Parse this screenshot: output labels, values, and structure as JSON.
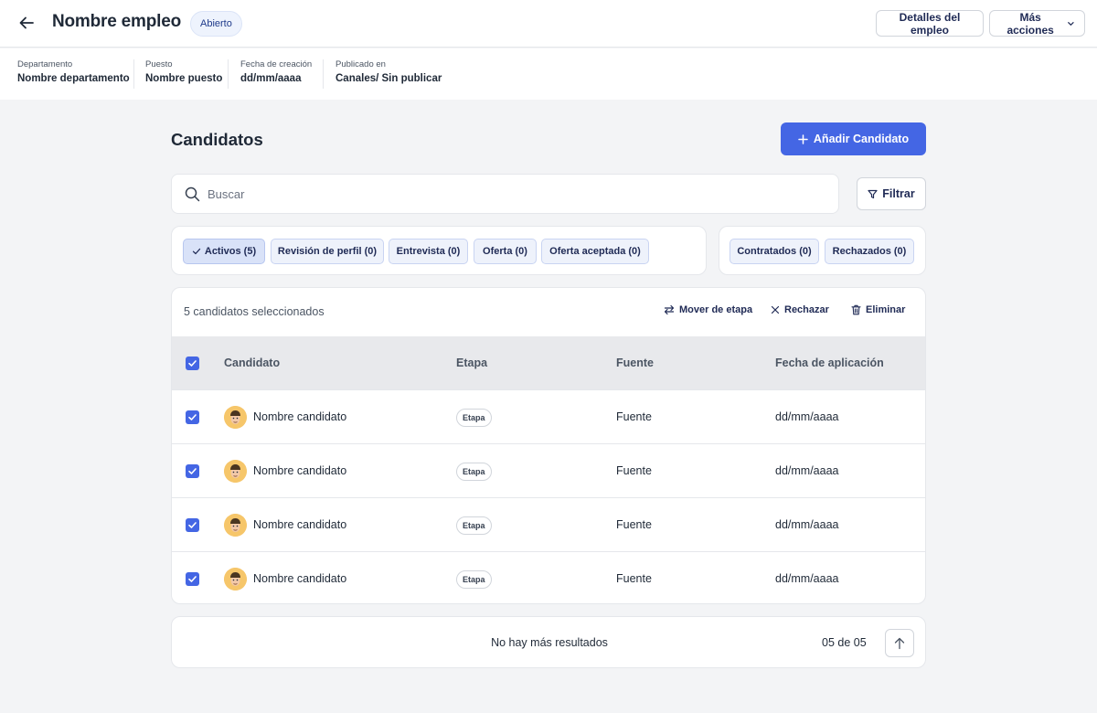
{
  "header": {
    "title": "Nombre empleo",
    "status": "Abierto",
    "details_label": "Detalles del empleo",
    "more_label": "Más acciones"
  },
  "meta": [
    {
      "label": "Departamento",
      "value": "Nombre departamento"
    },
    {
      "label": "Puesto",
      "value": "Nombre puesto"
    },
    {
      "label": "Fecha de creación",
      "value": "dd/mm/aaaa"
    },
    {
      "label": "Publicado en",
      "value": "Canales/ Sin publicar"
    }
  ],
  "main": {
    "title": "Candidatos",
    "add_label": "Añadir Candidato",
    "search_placeholder": "Buscar",
    "filter_label": "Filtrar"
  },
  "tabs": [
    {
      "label": "Activos (5)",
      "active": true
    },
    {
      "label": "Revisión de perfil (0)"
    },
    {
      "label": "Entrevista (0)"
    },
    {
      "label": "Oferta (0)"
    },
    {
      "label": "Oferta aceptada (0)"
    }
  ],
  "tabs_right": [
    {
      "label": "Contratados (0)"
    },
    {
      "label": "Rechazados (0)"
    }
  ],
  "bulk": {
    "selected_text": "5 candidatos seleccionados",
    "move_label": "Mover de etapa",
    "reject_label": "Rechazar",
    "delete_label": "Eliminar"
  },
  "table": {
    "columns": [
      "Candidato",
      "Etapa",
      "Fuente",
      "Fecha de aplicación"
    ],
    "rows": [
      {
        "name": "Nombre candidato",
        "stage": "Etapa",
        "source": "Fuente",
        "date": "dd/mm/aaaa"
      },
      {
        "name": "Nombre candidato",
        "stage": "Etapa",
        "source": "Fuente",
        "date": "dd/mm/aaaa"
      },
      {
        "name": "Nombre candidato",
        "stage": "Etapa",
        "source": "Fuente",
        "date": "dd/mm/aaaa"
      },
      {
        "name": "Nombre candidato",
        "stage": "Etapa",
        "source": "Fuente",
        "date": "dd/mm/aaaa"
      }
    ]
  },
  "footer": {
    "no_more": "No hay más resultados",
    "count": "05 de 05"
  },
  "colors": {
    "accent": "#4466e4",
    "navy_text": "#1f2a55"
  },
  "icons": [
    "arrow-left-icon",
    "chevron-down-icon",
    "plus-icon",
    "search-icon",
    "filter-icon",
    "check-icon",
    "swap-icon",
    "close-icon",
    "trash-icon",
    "arrow-up-icon"
  ]
}
